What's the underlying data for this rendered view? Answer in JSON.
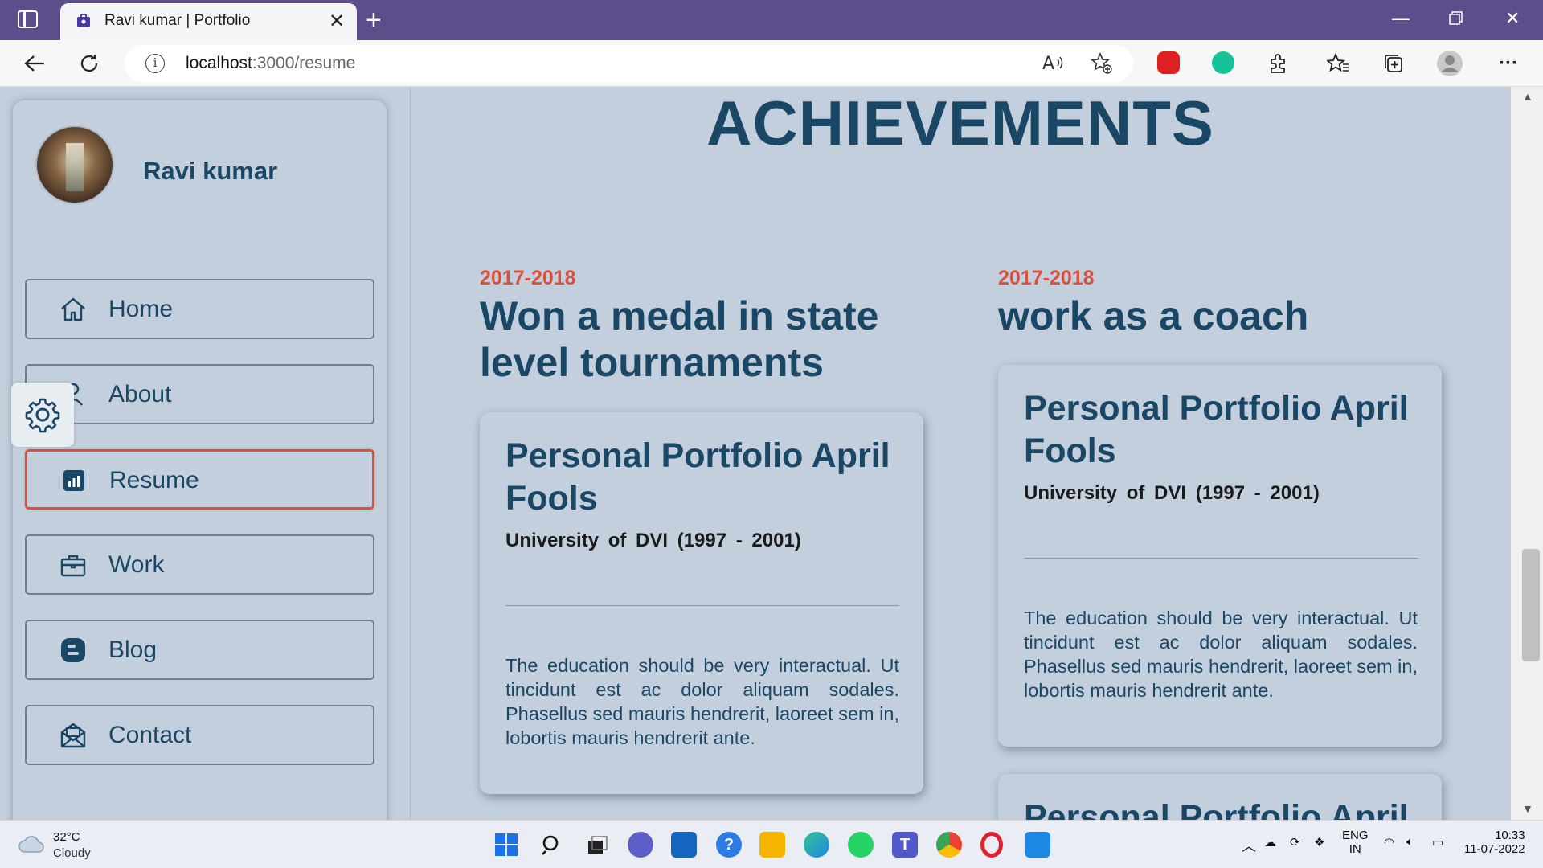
{
  "browser": {
    "tab_title": "Ravi kumar | Portfolio",
    "url_host": "localhost",
    "url_path": ":3000/resume"
  },
  "sidebar": {
    "profile_name": "Ravi kumar",
    "nav": [
      {
        "label": "Home",
        "icon": "home-icon"
      },
      {
        "label": "About",
        "icon": "user-icon"
      },
      {
        "label": "Resume",
        "icon": "chart-icon",
        "active": true
      },
      {
        "label": "Work",
        "icon": "briefcase-icon"
      },
      {
        "label": "Blog",
        "icon": "blogger-icon"
      },
      {
        "label": "Contact",
        "icon": "mail-icon"
      }
    ]
  },
  "main": {
    "section_title": "ACHIEVEMENTS",
    "achievements": [
      {
        "year": "2017-2018",
        "title": "Won a medal in state level tournaments",
        "card": {
          "title": "Personal Portfolio April Fools",
          "subtitle": "University of DVI (1997 - 2001)",
          "body": "The education should be very interactual. Ut tincidunt est ac dolor aliquam sodales. Phasellus sed mauris hendrerit, laoreet sem in, lobortis mauris hendrerit ante."
        }
      },
      {
        "year": "2017-2018",
        "title": "work as a coach",
        "card": {
          "title": "Personal Portfolio April Fools",
          "subtitle": "University of DVI (1997 - 2001)",
          "body": "The education should be very interactual. Ut tincidunt est ac dolor aliquam sodales. Phasellus sed mauris hendrerit, laoreet sem in, lobortis mauris hendrerit ante."
        },
        "next_card_title": "Personal Portfolio April"
      }
    ]
  },
  "taskbar": {
    "weather_temp": "32°C",
    "weather_desc": "Cloudy",
    "lang_1": "ENG",
    "lang_2": "IN",
    "time": "10:33",
    "date": "11-07-2022"
  },
  "colors": {
    "accent": "#d9513a",
    "heading": "#1b4766",
    "page_bg": "#c3cfdc",
    "titlebar": "#5d4d8a"
  }
}
